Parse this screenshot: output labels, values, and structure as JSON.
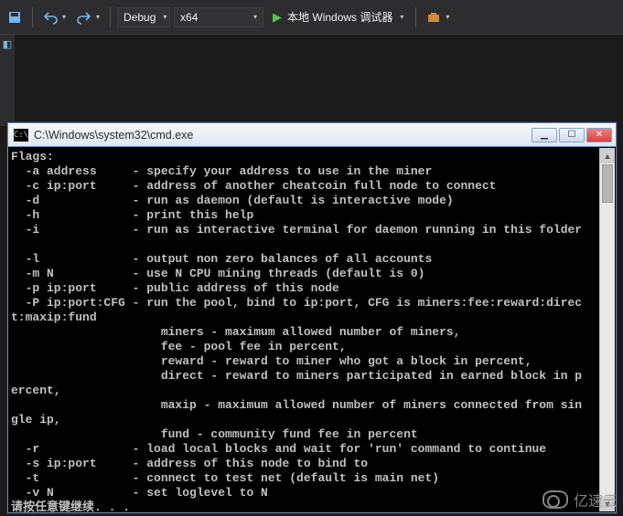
{
  "toolbar": {
    "undo_name": "undo-icon",
    "redo_name": "redo-icon",
    "config_value": "Debug",
    "platform_value": "x64",
    "play_label": "本地 Windows 调试器",
    "extra_icon_name": "toolbox-icon"
  },
  "side": {
    "icon1_name": "save-all-icon"
  },
  "cmd": {
    "title": "C:\\Windows\\system32\\cmd.exe",
    "icon_glyph": "C:\\",
    "lines": [
      "Flags:",
      "  -a address     - specify your address to use in the miner",
      "  -c ip:port     - address of another cheatcoin full node to connect",
      "  -d             - run as daemon (default is interactive mode)",
      "  -h             - print this help",
      "  -i             - run as interactive terminal for daemon running in this folder",
      "",
      "  -l             - output non zero balances of all accounts",
      "  -m N           - use N CPU mining threads (default is 0)",
      "  -p ip:port     - public address of this node",
      "  -P ip:port:CFG - run the pool, bind to ip:port, CFG is miners:fee:reward:direc",
      "t:maxip:fund",
      "                     miners - maximum allowed number of miners,",
      "                     fee - pool fee in percent,",
      "                     reward - reward to miner who got a block in percent,",
      "                     direct - reward to miners participated in earned block in p",
      "ercent,",
      "                     maxip - maximum allowed number of miners connected from sin",
      "gle ip,",
      "                     fund - community fund fee in percent",
      "  -r             - load local blocks and wait for 'run' command to continue",
      "  -s ip:port     - address of this node to bind to",
      "  -t             - connect to test net (default is main net)",
      "  -v N           - set loglevel to N",
      "请按任意键继续. . ."
    ]
  },
  "watermark": {
    "text": "亿速云"
  }
}
